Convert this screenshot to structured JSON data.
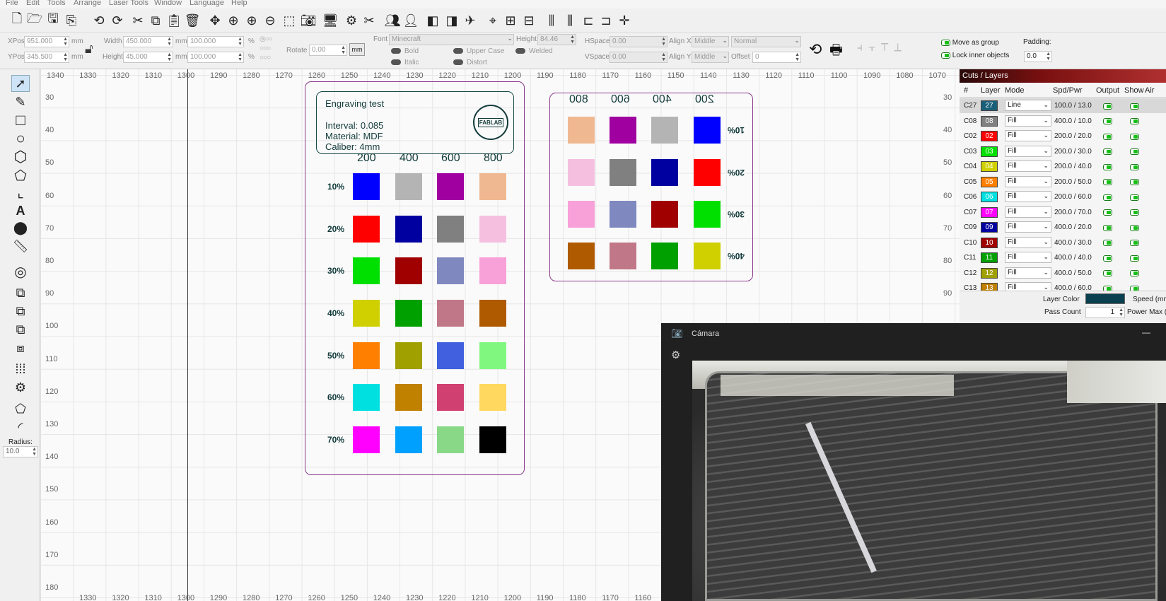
{
  "menu": [
    "File",
    "Edit",
    "Tools",
    "Arrange",
    "Laser Tools",
    "Window",
    "Language",
    "Help"
  ],
  "props": {
    "xpos_label": "XPos",
    "xpos": "951.000",
    "ypos_label": "YPos",
    "ypos": "345.500",
    "unit": "mm",
    "width_label": "Width",
    "width": "450.000",
    "height_label": "Height",
    "height": "45.000",
    "scale_w": "100.000",
    "scale_h": "100.000",
    "pct": "%",
    "rotate_label": "Rotate",
    "rotate": "0,00",
    "mm_button": "mm",
    "font_label": "Font",
    "font_value": "Minecraft",
    "fheight_label": "Height",
    "fheight": "84.46",
    "hspace_label": "HSpace",
    "hspace": "0.00",
    "vspace_label": "VSpace",
    "vspace": "0.00",
    "alignx_label": "Align X",
    "alignx": "Middle",
    "aligny_label": "Align Y",
    "aligny": "Middle",
    "normal": "Normal",
    "offset_label": "Offset",
    "offset": "0",
    "bold": "Bold",
    "italic": "Italic",
    "upper": "Upper Case",
    "distort": "Distort",
    "welded": "Welded",
    "move_group": "Move as group",
    "lock_inner": "Lock inner objects",
    "padding_label": "Padding:",
    "padding": "0.0"
  },
  "tools": {
    "radius_label": "Radius:",
    "radius": "10.0"
  },
  "ruler_top": [
    "1340",
    "1330",
    "1320",
    "1310",
    "1300",
    "1290",
    "1280",
    "1270",
    "1260",
    "1250",
    "1240",
    "1230",
    "1220",
    "1210",
    "1200",
    "1190",
    "1180",
    "1170",
    "1160",
    "1150",
    "1140",
    "1130",
    "1120",
    "1110",
    "1100",
    "1090",
    "1080",
    "1070"
  ],
  "ruler_bottom": [
    "1330",
    "1320",
    "1310",
    "1300",
    "1290",
    "1280",
    "1270",
    "1260",
    "1250",
    "1240",
    "1230",
    "1220",
    "1210",
    "1200",
    "1190",
    "1180",
    "1170",
    "1160"
  ],
  "ruler_left": [
    "30",
    "40",
    "50",
    "60",
    "70",
    "80",
    "90",
    "100",
    "110",
    "120",
    "130",
    "140",
    "150",
    "160",
    "170",
    "180"
  ],
  "ruler_right": [
    "30",
    "40",
    "50",
    "60",
    "70",
    "80",
    "90"
  ],
  "test_card": {
    "title": "Engraving test",
    "interval": "Interval: 0.085",
    "material": "Material: MDF",
    "caliber": "Caliber: 4mm",
    "logo": "FABLAB",
    "cols": [
      "200",
      "400",
      "600",
      "800"
    ],
    "rows": [
      "10%",
      "20%",
      "30%",
      "40%",
      "50%",
      "60%",
      "70%"
    ],
    "colors": [
      [
        "#0000ff",
        "#b4b4b4",
        "#a000a0",
        "#f0b890"
      ],
      [
        "#ff0000",
        "#0000a0",
        "#808080",
        "#f5c0e0"
      ],
      [
        "#00e000",
        "#a00000",
        "#8088c0",
        "#f8a0d8"
      ],
      [
        "#d0d000",
        "#00a000",
        "#c07888",
        "#b05a00"
      ],
      [
        "#ff8000",
        "#a0a000",
        "#4060e0",
        "#80f880"
      ],
      [
        "#00e0e0",
        "#c08000",
        "#d04070",
        "#ffd860"
      ],
      [
        "#ff00ff",
        "#00a0ff",
        "#88d888",
        "#000000"
      ]
    ]
  },
  "mirror_card": {
    "cols": [
      "800",
      "600",
      "400",
      "200"
    ],
    "rows": [
      "10%",
      "20%",
      "30%",
      "40%"
    ],
    "colors": [
      [
        "#f0b890",
        "#a000a0",
        "#b4b4b4",
        "#0000ff"
      ],
      [
        "#f5c0e0",
        "#808080",
        "#0000a0",
        "#ff0000"
      ],
      [
        "#f8a0d8",
        "#8088c0",
        "#a00000",
        "#00e000"
      ],
      [
        "#b05a00",
        "#c07888",
        "#00a000",
        "#d0d000"
      ]
    ]
  },
  "layers": {
    "title": "Cuts / Layers",
    "headers": [
      "#",
      "Layer",
      "Mode",
      "Spd/Pwr",
      "Output",
      "Show",
      "Air"
    ],
    "rows": [
      {
        "id": "C27",
        "num": "27",
        "color": "#1a5f7a",
        "mode": "Line",
        "spd": "100.0 / 13.0"
      },
      {
        "id": "C08",
        "num": "08",
        "color": "#808080",
        "mode": "Fill",
        "spd": "400.0 / 10.0"
      },
      {
        "id": "C02",
        "num": "02",
        "color": "#ff0000",
        "mode": "Fill",
        "spd": "200.0 / 20.0"
      },
      {
        "id": "C03",
        "num": "03",
        "color": "#00e000",
        "mode": "Fill",
        "spd": "200.0 / 30.0"
      },
      {
        "id": "C04",
        "num": "04",
        "color": "#d0d000",
        "mode": "Fill",
        "spd": "200.0 / 40.0"
      },
      {
        "id": "C05",
        "num": "05",
        "color": "#ff8000",
        "mode": "Fill",
        "spd": "200.0 / 50.0"
      },
      {
        "id": "C06",
        "num": "06",
        "color": "#00e0e0",
        "mode": "Fill",
        "spd": "200.0 / 60.0"
      },
      {
        "id": "C07",
        "num": "07",
        "color": "#ff00ff",
        "mode": "Fill",
        "spd": "200.0 / 70.0"
      },
      {
        "id": "C09",
        "num": "09",
        "color": "#0000a0",
        "mode": "Fill",
        "spd": "400.0 / 20.0"
      },
      {
        "id": "C10",
        "num": "10",
        "color": "#a00000",
        "mode": "Fill",
        "spd": "400.0 / 30.0"
      },
      {
        "id": "C11",
        "num": "11",
        "color": "#00a000",
        "mode": "Fill",
        "spd": "400.0 / 40.0"
      },
      {
        "id": "C12",
        "num": "12",
        "color": "#a0a000",
        "mode": "Fill",
        "spd": "400.0 / 50.0"
      },
      {
        "id": "C13",
        "num": "13",
        "color": "#c08000",
        "mode": "Fill",
        "spd": "400.0 / 60.0"
      }
    ],
    "layer_color_label": "Layer Color",
    "layer_color": "#0a3f4f",
    "speed_label": "Speed (mm",
    "pass_label": "Pass Count",
    "pass": "1",
    "power_label": "Power Max ("
  },
  "camera": {
    "title": "Cámara",
    "minimize": "—"
  }
}
